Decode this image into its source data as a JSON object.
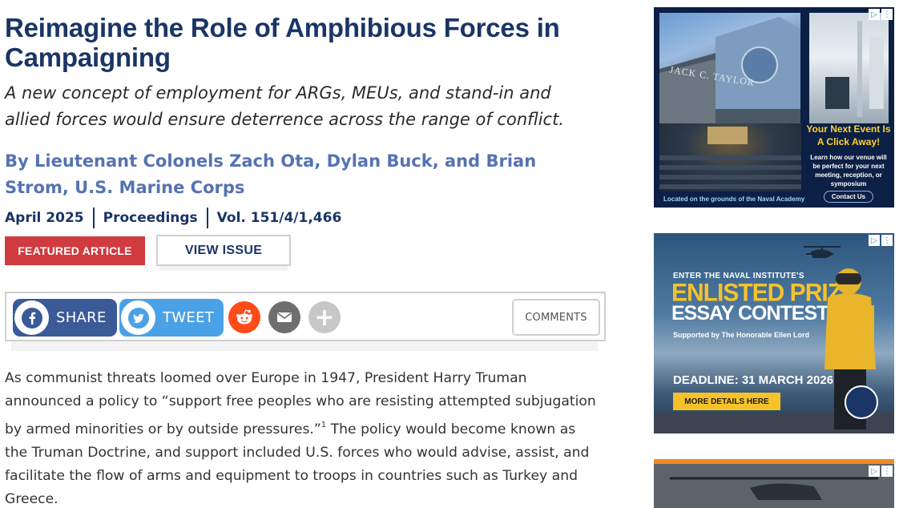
{
  "article": {
    "title": "Reimagine the Role of Amphibious Forces in Campaigning",
    "subtitle": "A new concept of employment for ARGs, MEUs, and stand-in and allied forces would ensure deterrence across the range of conflict.",
    "byline": "By Lieutenant Colonels Zach Ota, Dylan Buck, and Brian Strom, U.S. Marine Corps",
    "meta": {
      "date": "April 2025",
      "publication": "Proceedings",
      "volume": "Vol. 151/4/1,466"
    },
    "featured_label": "FEATURED ARTICLE",
    "view_issue_label": "VIEW ISSUE",
    "body_part1": "As communist threats loomed over Europe in 1947, President Harry Truman announced a policy to “support free peoples who are resisting attempted subjugation by armed minorities or by outside pressures.”",
    "footnote": "1",
    "body_part2": " The policy would become known as the Truman Doctrine, and support included U.S. forces who would advise, assist, and facilitate the flow of arms and equipment to troops in countries such as Turkey and Greece."
  },
  "share": {
    "share_label": "SHARE",
    "tweet_label": "TWEET",
    "more_symbol": "+",
    "comments_label": "COMMENTS"
  },
  "ads": {
    "ad1": {
      "building_sign": "JACK C. TAYLOR",
      "headline": "Your Next Event Is A Click Away!",
      "subtext": "Learn how our venue will be perfect for your next meeting, reception, or symposium",
      "button": "Contact Us",
      "location": "Located on the grounds of the Naval Academy"
    },
    "ad2": {
      "kicker": "ENTER THE NAVAL INSTITUTE'S",
      "title1": "ENLISTED PRIZE",
      "title2": "ESSAY CONTEST",
      "support": "Supported by The Honorable Ellen Lord",
      "deadline": "DEADLINE: 31 MARCH 2026",
      "button": "MORE DETAILS HERE"
    }
  },
  "colors": {
    "title": "#1a3566",
    "byline": "#5573b3",
    "featured": "#d03b3f",
    "facebook": "#3a5a98",
    "twitter": "#4ba1e6",
    "reddit": "#ff4b18",
    "email": "#6e6e6e"
  },
  "icons": [
    "facebook-icon",
    "twitter-icon",
    "reddit-icon",
    "email-icon",
    "plus-icon",
    "adchoices-icon",
    "close-x-icon"
  ]
}
